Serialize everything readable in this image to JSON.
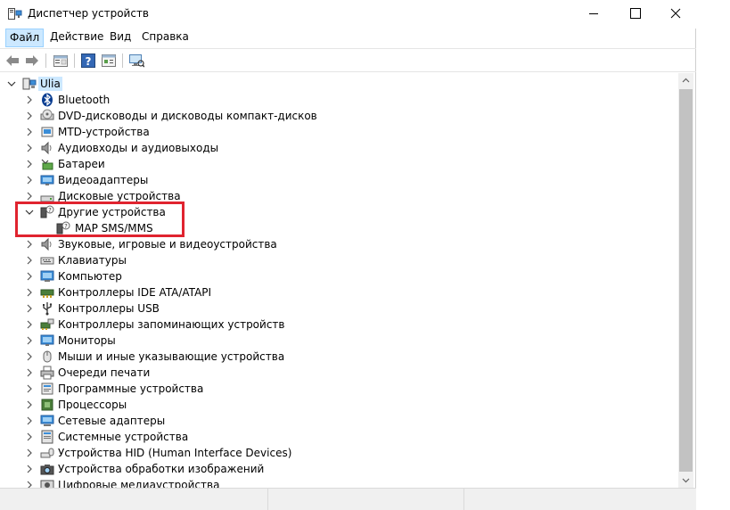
{
  "window": {
    "title": "Диспетчер устройств",
    "icons": {
      "app": "device-manager-icon",
      "minimize": "minimize-icon",
      "maximize": "maximize-icon",
      "close": "close-icon"
    }
  },
  "menu": {
    "file": "Файл",
    "action": "Действие",
    "view": "Вид",
    "help": "Справка"
  },
  "toolbar": {
    "buttons": [
      "back-arrow-icon",
      "forward-arrow-icon",
      "properties-icon",
      "help-icon",
      "view-icon",
      "scan-hardware-icon"
    ]
  },
  "tree": {
    "root": {
      "label": "Ulia",
      "icon": "computer-icon",
      "expanded": true
    },
    "items": [
      {
        "label": "Bluetooth",
        "icon": "bluetooth-icon"
      },
      {
        "label": "DVD-дисководы и дисководы компакт-дисков",
        "icon": "dvd-drive-icon"
      },
      {
        "label": "MTD-устройства",
        "icon": "mtd-device-icon"
      },
      {
        "label": "Аудиовходы и аудиовыходы",
        "icon": "speaker-icon"
      },
      {
        "label": "Батареи",
        "icon": "battery-icon"
      },
      {
        "label": "Видеоадаптеры",
        "icon": "display-adapter-icon"
      },
      {
        "label": "Дисковые устройства",
        "icon": "disk-drive-icon"
      },
      {
        "label": "Другие устройства",
        "icon": "unknown-device-icon",
        "expanded": true,
        "children": [
          {
            "label": "MAP SMS/MMS",
            "icon": "unknown-device-icon"
          }
        ]
      },
      {
        "label": "Звуковые, игровые и видеоустройства",
        "icon": "sound-icon"
      },
      {
        "label": "Клавиатуры",
        "icon": "keyboard-icon"
      },
      {
        "label": "Компьютер",
        "icon": "computer-monitor-icon"
      },
      {
        "label": "Контроллеры IDE ATA/ATAPI",
        "icon": "ide-controller-icon"
      },
      {
        "label": "Контроллеры USB",
        "icon": "usb-icon"
      },
      {
        "label": "Контроллеры запоминающих устройств",
        "icon": "storage-controller-icon"
      },
      {
        "label": "Мониторы",
        "icon": "monitor-icon"
      },
      {
        "label": "Мыши и иные указывающие устройства",
        "icon": "mouse-icon"
      },
      {
        "label": "Очереди печати",
        "icon": "printer-icon"
      },
      {
        "label": "Программные устройства",
        "icon": "software-device-icon"
      },
      {
        "label": "Процессоры",
        "icon": "processor-icon"
      },
      {
        "label": "Сетевые адаптеры",
        "icon": "network-adapter-icon"
      },
      {
        "label": "Системные устройства",
        "icon": "system-device-icon"
      },
      {
        "label": "Устройства HID (Human Interface Devices)",
        "icon": "hid-icon"
      },
      {
        "label": "Устройства обработки изображений",
        "icon": "camera-icon"
      },
      {
        "label": "Цифровые медиаустройства",
        "icon": "media-device-icon"
      }
    ]
  },
  "colors": {
    "selection": "#cce8ff",
    "highlight_box": "#e0232f",
    "scrollbar_thumb": "#c2c2c2"
  }
}
